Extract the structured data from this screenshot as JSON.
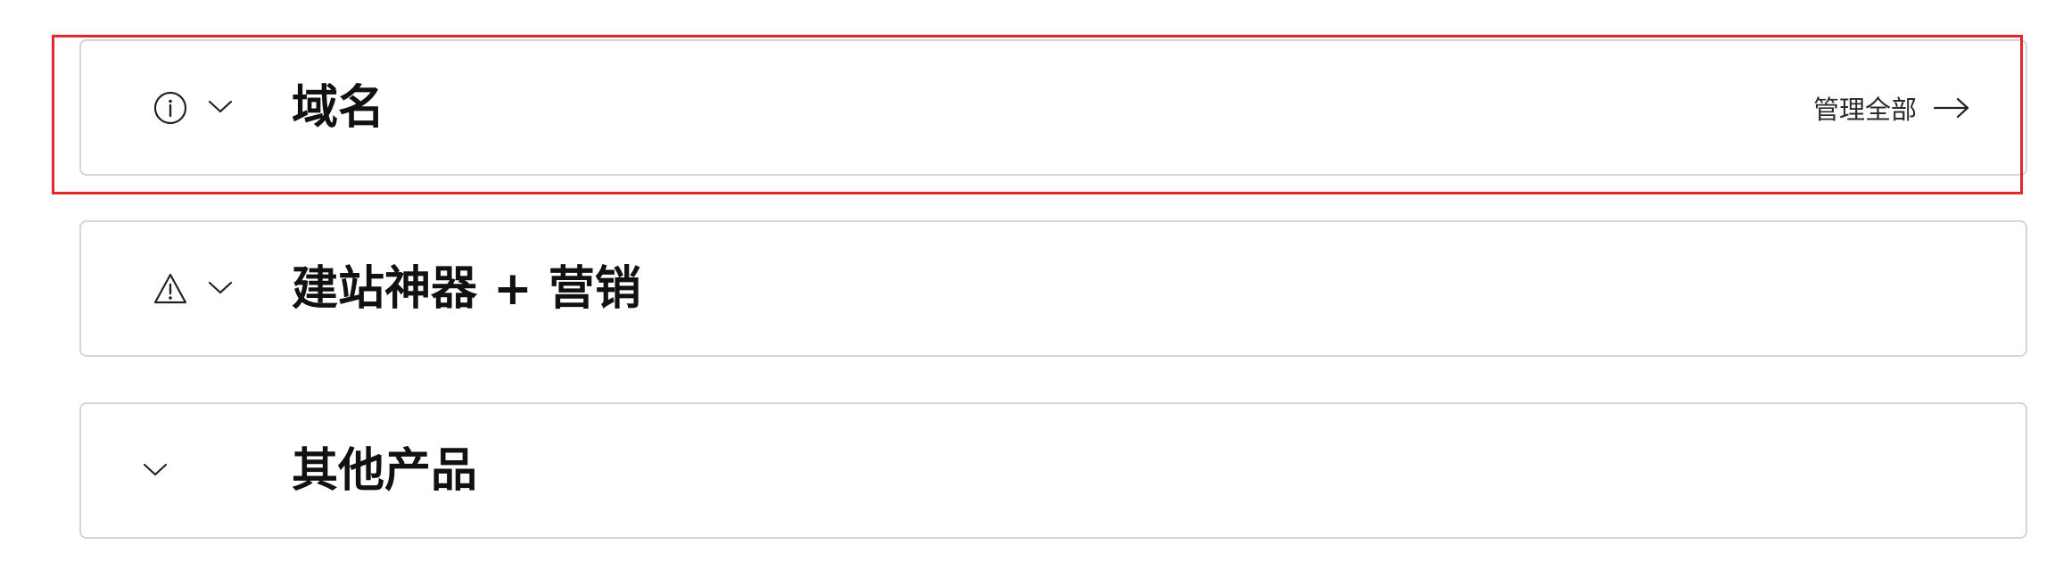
{
  "sections": [
    {
      "title": "域名",
      "status_icon": "info-circle-icon",
      "expand_icon": "chevron-down-icon",
      "action_label": "管理全部",
      "action_icon": "arrow-right-icon"
    },
    {
      "title": "建站神器 + 营销",
      "status_icon": "warning-triangle-icon",
      "expand_icon": "chevron-down-icon"
    },
    {
      "title": "其他产品",
      "expand_icon": "chevron-down-icon"
    }
  ],
  "colors": {
    "highlight": "#e3262c",
    "card_border": "#d6d6d6",
    "text": "#111111"
  }
}
